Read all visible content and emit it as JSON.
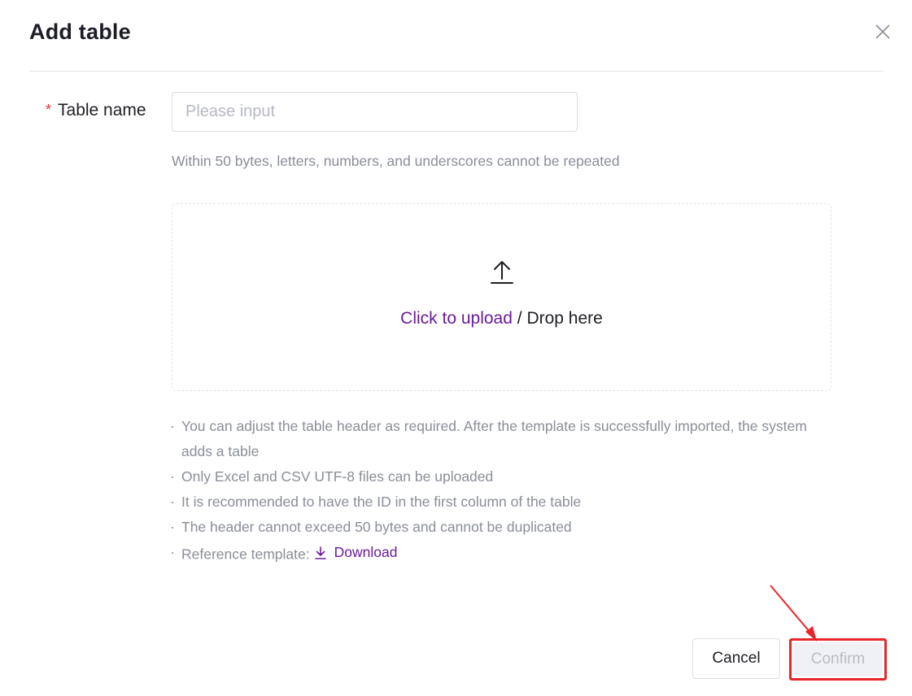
{
  "dialog": {
    "title": "Add table",
    "close_icon": "close-icon"
  },
  "form": {
    "table_name": {
      "required_mark": "*",
      "label": "Table name",
      "value": "",
      "placeholder": "Please input",
      "hint": "Within 50 bytes, letters, numbers, and underscores cannot be repeated"
    },
    "upload": {
      "icon": "upload-icon",
      "click_label": "Click to upload",
      "separator": " / ",
      "drop_label": "Drop here"
    },
    "notes": [
      "You can adjust the table header as required. After the template is successfully imported, the system adds a table",
      "Only Excel and CSV UTF-8 files can be uploaded",
      "It is recommended to have the ID in the first column of the table",
      "The header cannot exceed 50 bytes and cannot be duplicated"
    ],
    "reference": {
      "label": "Reference template:",
      "download_icon": "download-icon",
      "download_label": "Download"
    }
  },
  "footer": {
    "cancel_label": "Cancel",
    "confirm_label": "Confirm"
  },
  "colors": {
    "accent": "#6a1b9a",
    "required": "#e5302c",
    "annotation": "#e8262a"
  }
}
